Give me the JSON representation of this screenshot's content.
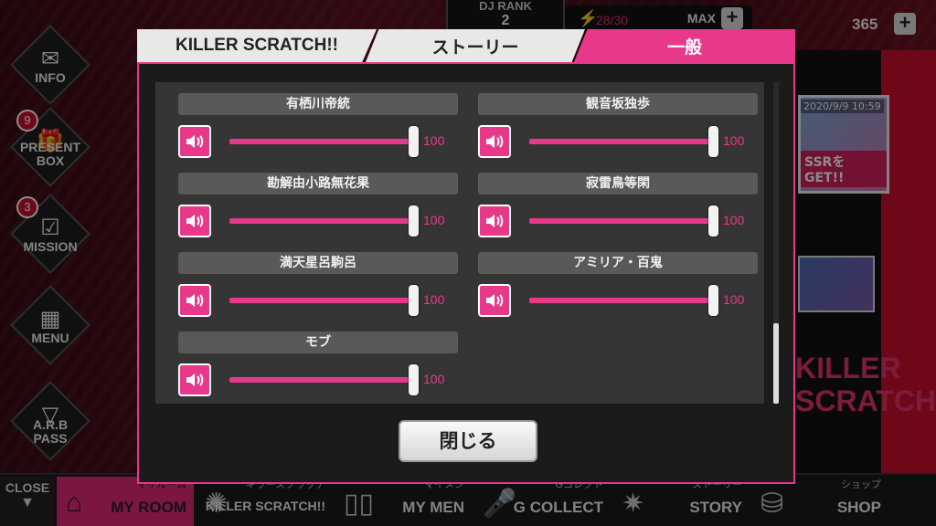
{
  "top": {
    "dj_rank_label": "DJ RANK",
    "dj_rank_value": "2",
    "stamina": "28/30",
    "max_label": "MAX",
    "coins": "365"
  },
  "side_menu": [
    {
      "label": "INFO",
      "badge": ""
    },
    {
      "label": "PRESENT\nBOX",
      "badge": "9"
    },
    {
      "label": "MISSION",
      "badge": "3"
    },
    {
      "label": "MENU",
      "badge": ""
    },
    {
      "label": "A.R.B\nPASS",
      "badge": ""
    }
  ],
  "bg_cards": {
    "date": "2020/9/9 10:59",
    "ssr_text": "SSRをGET!!",
    "killer_text": "KILLER\nSCRATCH!!"
  },
  "bottom_nav": {
    "close_label": "CLOSE",
    "items": [
      {
        "sub": "マイルーム",
        "main": "MY ROOM",
        "icon": "house-icon"
      },
      {
        "sub": "キラースクラッチ",
        "main": "KILLER SCRATCH!!",
        "icon": "scratch-icon"
      },
      {
        "sub": "マイメン",
        "main": "MY MEN",
        "icon": "cards-icon"
      },
      {
        "sub": "Gコレクト",
        "main": "G COLLECT",
        "icon": "mic-icon"
      },
      {
        "sub": "ストーリー",
        "main": "STORY",
        "icon": "burst-icon"
      },
      {
        "sub": "ショップ",
        "main": "SHOP",
        "icon": "shop-icon"
      }
    ]
  },
  "tabs": [
    {
      "label": "KILLER SCRATCH!!",
      "active": false
    },
    {
      "label": "ストーリー",
      "active": false
    },
    {
      "label": "一般",
      "active": true
    }
  ],
  "volumes": [
    {
      "name": "有栖川帝統",
      "value": 100
    },
    {
      "name": "観音坂独歩",
      "value": 100
    },
    {
      "name": "勘解由小路無花果",
      "value": 100
    },
    {
      "name": "寂雷鳥等閑",
      "value": 100
    },
    {
      "name": "満天星呂駒呂",
      "value": 100
    },
    {
      "name": "アミリア・百鬼",
      "value": 100
    },
    {
      "name": "モブ",
      "value": 100
    }
  ],
  "close_button_label": "閉じる",
  "colors": {
    "accent": "#e8388a",
    "panel": "#1b1b1b",
    "row": "#595959"
  }
}
